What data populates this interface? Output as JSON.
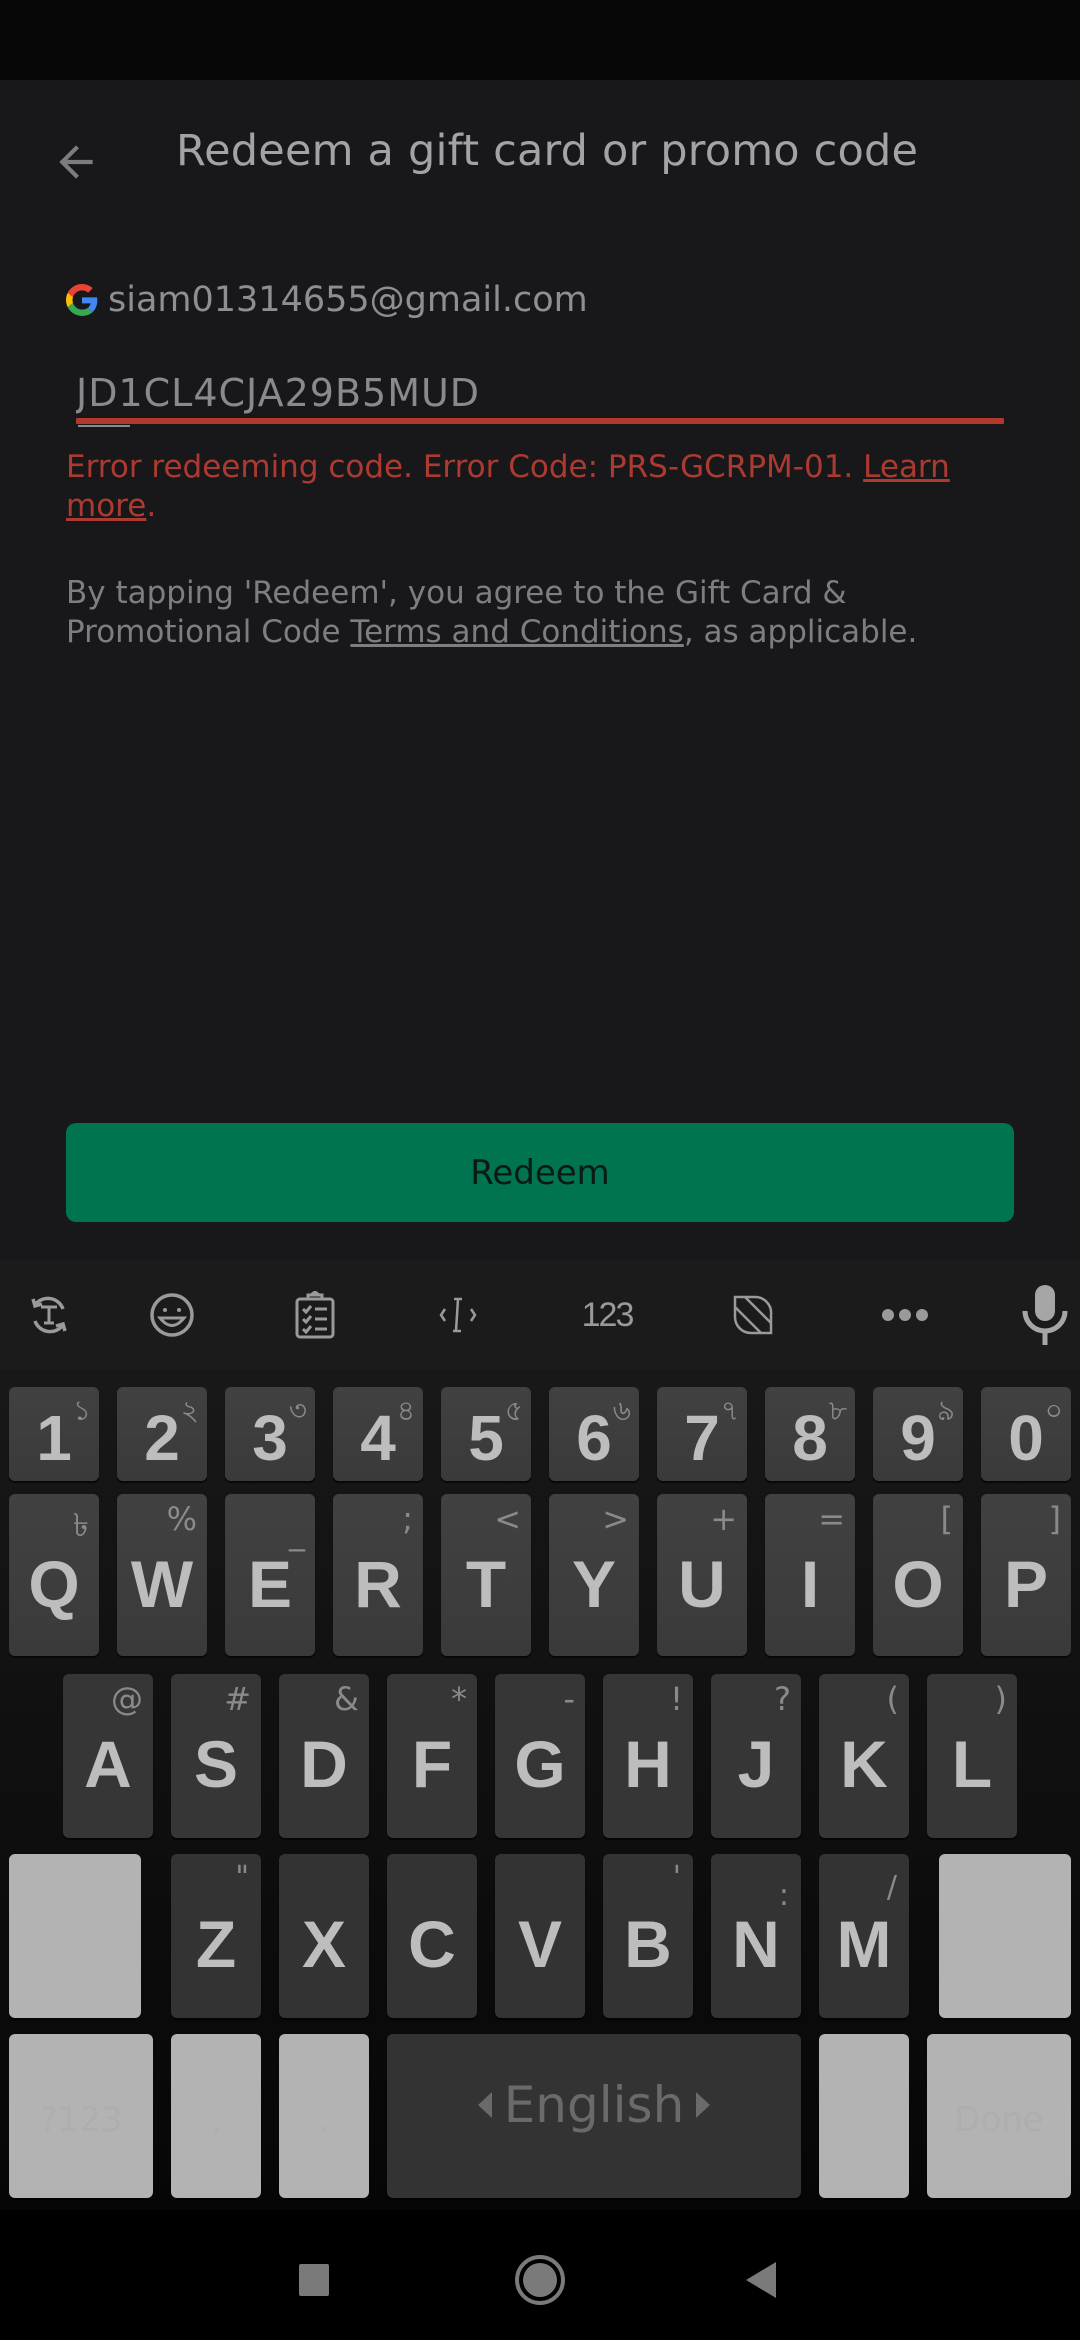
{
  "header": {
    "title": "Redeem a gift card or promo code",
    "back_icon": "arrow-left-icon"
  },
  "account": {
    "provider_icon": "google-g-icon",
    "email": "siam01314655@gmail.com"
  },
  "code_input": {
    "value": "JD1CL4CJA29B5MUD",
    "composing_prefix": "JD"
  },
  "error": {
    "text": "Error redeeming code. Error Code: PRS-GCRPM-01. ",
    "link_label": "Learn more",
    "suffix": ".",
    "color": "#ad3a30"
  },
  "terms": {
    "prefix": "By tapping 'Redeem', you agree to the Gift Card & Promotional Code ",
    "link_label": "Terms and Conditions",
    "suffix": ", as applicable."
  },
  "redeem_button": {
    "label": "Redeem",
    "color": "#007351"
  },
  "keyboard": {
    "toolbar": [
      {
        "name": "translate-text-icon"
      },
      {
        "name": "emoji-icon"
      },
      {
        "name": "clipboard-icon"
      },
      {
        "name": "text-cursor-icon"
      },
      {
        "name": "number-pad",
        "label": "123"
      },
      {
        "name": "theme-icon"
      },
      {
        "name": "more-icon"
      },
      {
        "name": "microphone-icon"
      }
    ],
    "number_row": [
      {
        "key": "1",
        "hint": "১"
      },
      {
        "key": "2",
        "hint": "২"
      },
      {
        "key": "3",
        "hint": "৩"
      },
      {
        "key": "4",
        "hint": "৪"
      },
      {
        "key": "5",
        "hint": "৫"
      },
      {
        "key": "6",
        "hint": "৬"
      },
      {
        "key": "7",
        "hint": "৭"
      },
      {
        "key": "8",
        "hint": "৮"
      },
      {
        "key": "9",
        "hint": "৯"
      },
      {
        "key": "0",
        "hint": "০"
      }
    ],
    "row1": [
      {
        "key": "Q",
        "hint": "৳"
      },
      {
        "key": "W",
        "hint": "%"
      },
      {
        "key": "E",
        "hint": "_"
      },
      {
        "key": "R",
        "hint": ";"
      },
      {
        "key": "T",
        "hint": "<"
      },
      {
        "key": "Y",
        "hint": ">"
      },
      {
        "key": "U",
        "hint": "+"
      },
      {
        "key": "I",
        "hint": "="
      },
      {
        "key": "O",
        "hint": "["
      },
      {
        "key": "P",
        "hint": "]"
      }
    ],
    "row2": [
      {
        "key": "A",
        "hint": "@"
      },
      {
        "key": "S",
        "hint": "#"
      },
      {
        "key": "D",
        "hint": "&"
      },
      {
        "key": "F",
        "hint": "*"
      },
      {
        "key": "G",
        "hint": "-"
      },
      {
        "key": "H",
        "hint": "!"
      },
      {
        "key": "J",
        "hint": "?"
      },
      {
        "key": "K",
        "hint": "("
      },
      {
        "key": "L",
        "hint": ")"
      }
    ],
    "row3": [
      {
        "key": "Z",
        "hint": "\""
      },
      {
        "key": "X",
        "hint": ""
      },
      {
        "key": "C",
        "hint": ""
      },
      {
        "key": "V",
        "hint": ""
      },
      {
        "key": "B",
        "hint": "'"
      },
      {
        "key": "N",
        "hint": ":"
      },
      {
        "key": "M",
        "hint": "/"
      }
    ],
    "shift_label": "",
    "backspace_label": "",
    "symbols_label": "?123",
    "comma_label": ",",
    "period_label": ".",
    "space_label": "English",
    "done_label": "Done"
  },
  "nav_bar": {
    "recents": "recents-icon",
    "home": "home-icon",
    "back": "back-icon"
  }
}
